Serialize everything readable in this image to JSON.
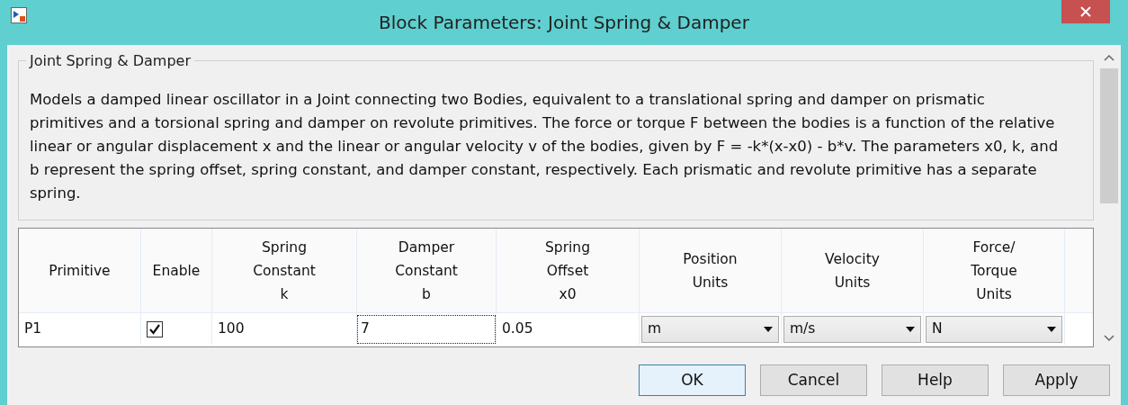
{
  "window": {
    "title": "Block Parameters: Joint Spring & Damper"
  },
  "group": {
    "title": "Joint Spring & Damper",
    "description": "Models a damped linear oscillator in a Joint connecting two Bodies, equivalent to a translational spring and damper on prismatic primitives and a torsional spring and damper on revolute primitives. The force or torque F between the bodies is a function of the relative linear or angular displacement x and the linear or angular velocity v of the bodies, given by F = -k*(x-x0) - b*v. The parameters x0, k, and b represent the spring offset, spring constant, and damper constant, respectively. Each prismatic and revolute primitive has a separate spring."
  },
  "table": {
    "columns": [
      {
        "lines": [
          "Primitive"
        ]
      },
      {
        "lines": [
          "Enable"
        ]
      },
      {
        "lines": [
          "Spring",
          "Constant",
          "k"
        ]
      },
      {
        "lines": [
          "Damper",
          "Constant",
          "b"
        ]
      },
      {
        "lines": [
          "Spring",
          "Offset",
          "x0"
        ]
      },
      {
        "lines": [
          "Position",
          "Units"
        ]
      },
      {
        "lines": [
          "Velocity",
          "Units"
        ]
      },
      {
        "lines": [
          "Force/",
          "Torque",
          "Units"
        ]
      }
    ],
    "rows": [
      {
        "cells": [
          {
            "kind": "text",
            "value": "P1"
          },
          {
            "kind": "checkbox",
            "checked": true
          },
          {
            "kind": "text",
            "value": "100"
          },
          {
            "kind": "text",
            "value": "7",
            "focused": true
          },
          {
            "kind": "text",
            "value": "0.05"
          },
          {
            "kind": "dropdown",
            "value": "m"
          },
          {
            "kind": "dropdown",
            "value": "m/s"
          },
          {
            "kind": "dropdown",
            "value": "N"
          }
        ]
      }
    ]
  },
  "buttons": [
    {
      "label": "OK",
      "default": true
    },
    {
      "label": "Cancel",
      "default": false
    },
    {
      "label": "Help",
      "default": false
    },
    {
      "label": "Apply",
      "default": false
    }
  ]
}
